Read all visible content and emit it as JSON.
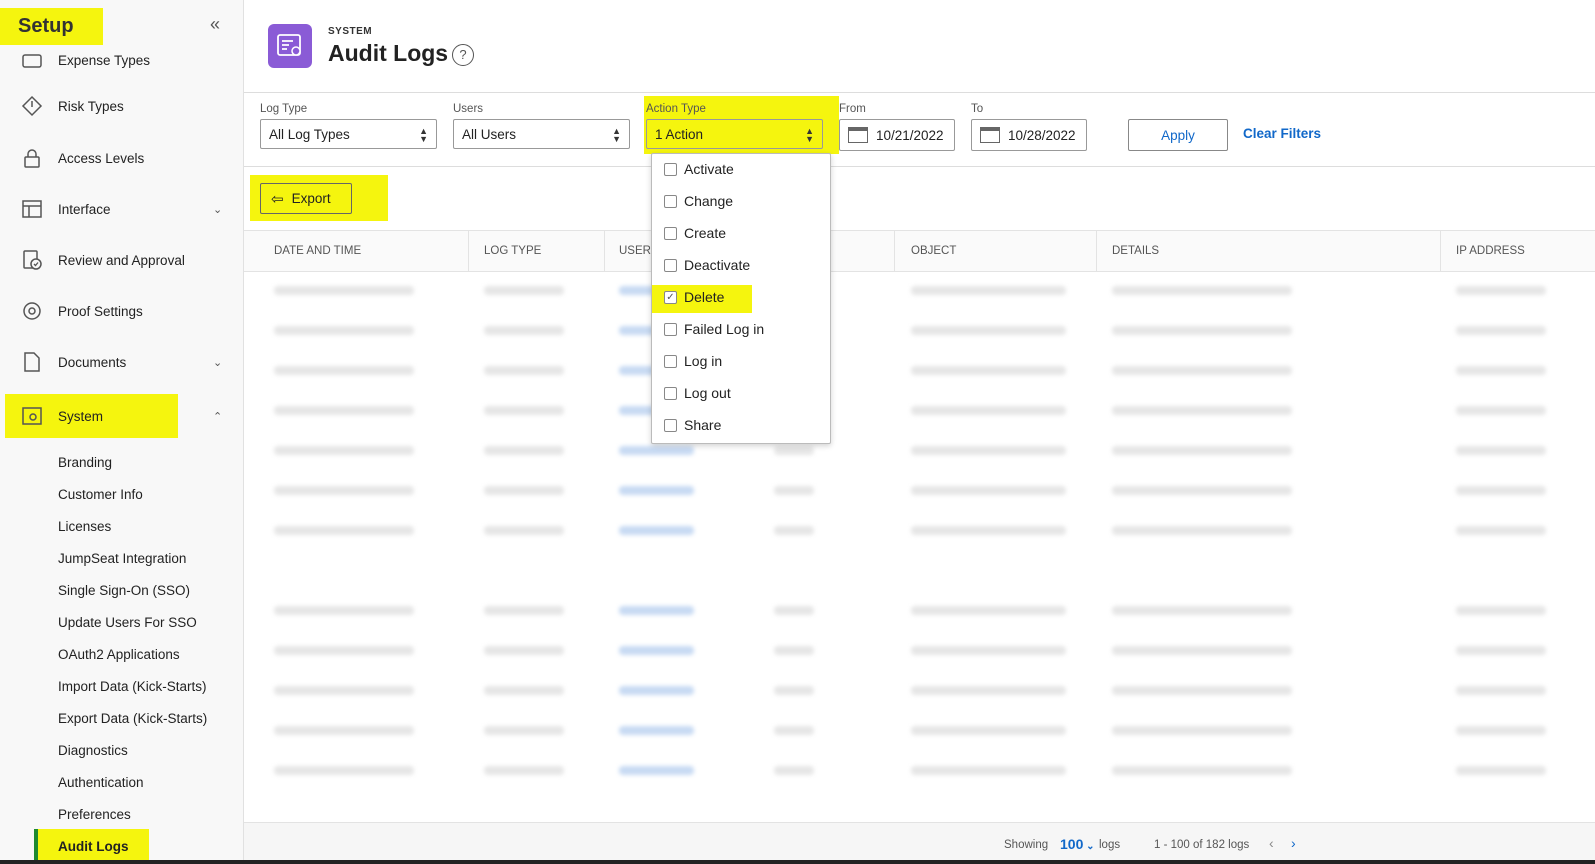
{
  "sidebar": {
    "title": "Setup",
    "items": [
      {
        "label": "Expense Types",
        "icon": "expense-types-icon"
      },
      {
        "label": "Risk Types",
        "icon": "risk-types-icon"
      },
      {
        "label": "Access Levels",
        "icon": "lock-icon"
      },
      {
        "label": "Interface",
        "icon": "interface-icon"
      },
      {
        "label": "Review and Approval",
        "icon": "review-approval-icon"
      },
      {
        "label": "Proof Settings",
        "icon": "proof-settings-icon"
      },
      {
        "label": "Documents",
        "icon": "document-icon"
      },
      {
        "label": "System",
        "icon": "system-icon"
      }
    ],
    "system_subitems": [
      "Branding",
      "Customer Info",
      "Licenses",
      "JumpSeat Integration",
      "Single Sign-On (SSO)",
      "Update Users For SSO",
      "OAuth2 Applications",
      "Import Data (Kick-Starts)",
      "Export Data (Kick-Starts)",
      "Diagnostics",
      "Authentication",
      "Preferences",
      "Audit Logs"
    ],
    "highlight_color": "#f5f50e"
  },
  "header": {
    "breadcrumb": "SYSTEM",
    "title": "Audit Logs",
    "help": "?"
  },
  "filters": {
    "log_type": {
      "label": "Log Type",
      "value": "All Log Types"
    },
    "users": {
      "label": "Users",
      "value": "All Users"
    },
    "action_type": {
      "label": "Action Type",
      "value": "1 Action"
    },
    "from": {
      "label": "From",
      "value": "10/21/2022"
    },
    "to": {
      "label": "To",
      "value": "10/28/2022"
    },
    "apply": "Apply",
    "clear": "Clear Filters"
  },
  "action_dropdown": {
    "options": [
      {
        "label": "Activate",
        "checked": false
      },
      {
        "label": "Change",
        "checked": false
      },
      {
        "label": "Create",
        "checked": false
      },
      {
        "label": "Deactivate",
        "checked": false
      },
      {
        "label": "Delete",
        "checked": true
      },
      {
        "label": "Failed Log in",
        "checked": false
      },
      {
        "label": "Log in",
        "checked": false
      },
      {
        "label": "Log out",
        "checked": false
      },
      {
        "label": "Share",
        "checked": false
      }
    ]
  },
  "toolbar": {
    "export": "Export"
  },
  "table": {
    "columns": [
      "DATE AND TIME",
      "LOG TYPE",
      "USER N",
      "OBJECT",
      "DETAILS",
      "IP ADDRESS"
    ]
  },
  "footer": {
    "showing": "Showing",
    "page_size": "100",
    "logs": "logs",
    "range": "1 - 100 of 182 logs",
    "prev": "‹",
    "next": "›"
  },
  "colors": {
    "accent": "#1168c9",
    "app_icon": "#8a5bd6",
    "active_bar": "#1e8a2f"
  }
}
